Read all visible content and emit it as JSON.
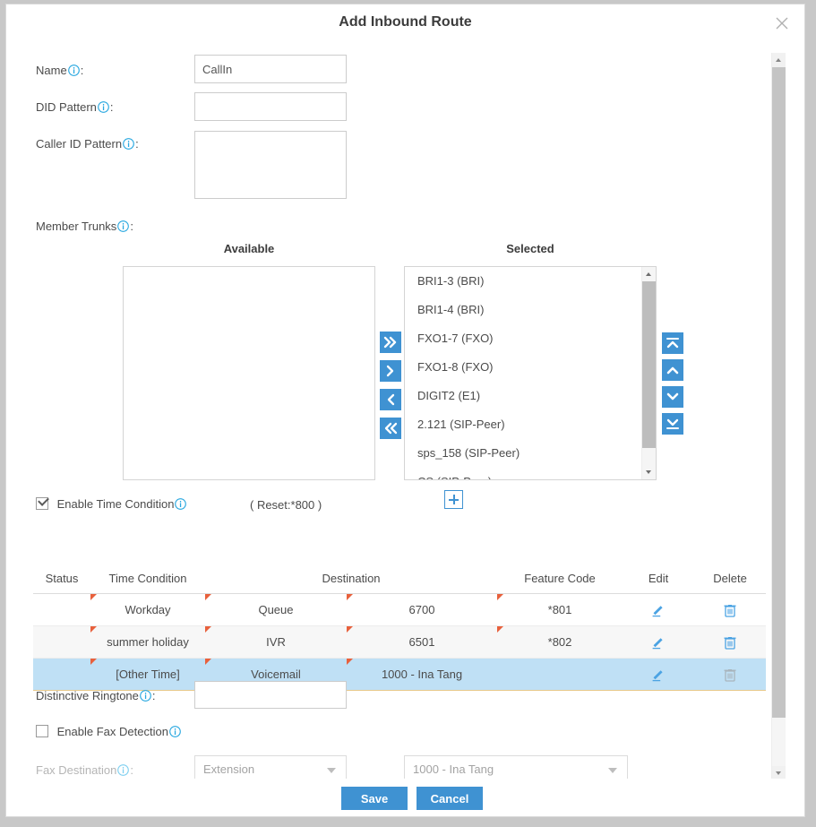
{
  "dialog": {
    "title": "Add Inbound Route",
    "close_label": "×"
  },
  "form": {
    "name": {
      "label": "Name",
      "value": "CallIn",
      "placeholder": ""
    },
    "did_pattern": {
      "label": "DID Pattern",
      "value": "",
      "placeholder": ""
    },
    "caller_id_pattern": {
      "label": "Caller ID Pattern",
      "value": "",
      "placeholder": ""
    },
    "member_trunks": {
      "label": "Member Trunks"
    },
    "distinctive_ringtone": {
      "label": "Distinctive Ringtone",
      "value": "",
      "placeholder": ""
    },
    "enable_fax_detection": {
      "label": "Enable Fax Detection",
      "checked": false
    },
    "fax_destination": {
      "label": "Fax Destination",
      "type_value": "Extension",
      "target_value": "1000 - Ina Tang"
    }
  },
  "trunks": {
    "available_caption": "Available",
    "selected_caption": "Selected",
    "available": [],
    "selected": [
      "BRI1-3 (BRI)",
      "BRI1-4 (BRI)",
      "FXO1-7 (FXO)",
      "FXO1-8 (FXO)",
      "DIGIT2 (E1)",
      "2.121 (SIP-Peer)",
      "sps_158 (SIP-Peer)",
      "CS (SIP-Peer)"
    ],
    "transfer_buttons": [
      {
        "name": "move-all-right",
        "glyph": "»"
      },
      {
        "name": "move-right",
        "glyph": "›"
      },
      {
        "name": "move-left",
        "glyph": "‹"
      },
      {
        "name": "move-all-left",
        "glyph": "«"
      }
    ],
    "order_buttons": [
      {
        "name": "move-to-top",
        "glyph": "⤒"
      },
      {
        "name": "move-up",
        "glyph": "^"
      },
      {
        "name": "move-down",
        "glyph": "v"
      },
      {
        "name": "move-to-bottom",
        "glyph": "⤓"
      }
    ]
  },
  "time_condition": {
    "enable_label": "Enable Time Condition",
    "enabled": true,
    "reset_text": "( Reset:*800 )",
    "add_label": "+",
    "columns": [
      "Status",
      "Time Condition",
      "Destination",
      "",
      "Feature Code",
      "Edit",
      "Delete"
    ],
    "rows": [
      {
        "status": "",
        "time_condition": "Workday",
        "destination_type": "Queue",
        "destination_value": "6700",
        "feature_code": "*801",
        "edit": "edit-icon",
        "delete": "delete-icon",
        "delete_enabled": true,
        "selected": false
      },
      {
        "status": "",
        "time_condition": "summer holiday",
        "destination_type": "IVR",
        "destination_value": "6501",
        "feature_code": "*802",
        "edit": "edit-icon",
        "delete": "delete-icon",
        "delete_enabled": true,
        "selected": false
      },
      {
        "status": "",
        "time_condition": "[Other Time]",
        "destination_type": "Voicemail",
        "destination_value": "1000 - Ina Tang",
        "feature_code": "",
        "edit": "edit-icon",
        "delete": "delete-icon",
        "delete_enabled": false,
        "selected": true
      }
    ]
  },
  "footer": {
    "save_label": "Save",
    "cancel_label": "Cancel"
  },
  "colors": {
    "accent": "#3f92d2",
    "selected_row": "#bfe0f5",
    "marker": "#e8603c",
    "info_icon": "#29a8e0"
  }
}
